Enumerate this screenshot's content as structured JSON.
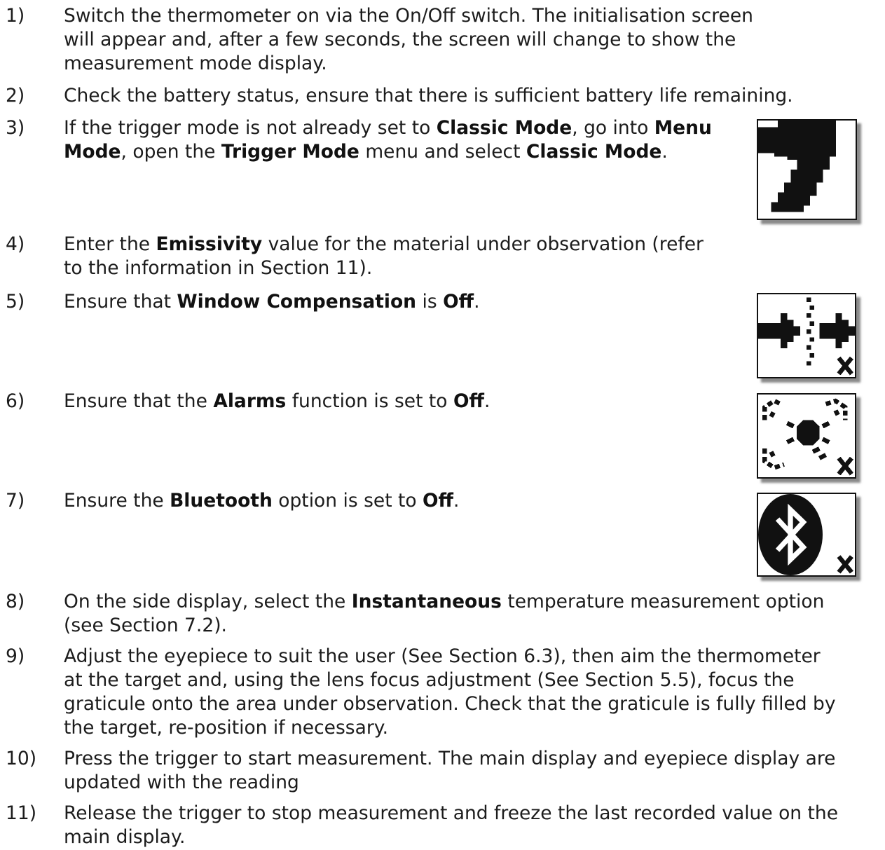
{
  "steps": [
    {
      "num": "1)",
      "parts": [
        {
          "t": "Switch the thermometer on via the On/Off switch. The initialisation screen will appear and, after a few seconds, the screen will change to show the measurement mode display."
        }
      ]
    },
    {
      "num": "2)",
      "parts": [
        {
          "t": "Check the battery status, ensure that there is sufficient battery life remaining."
        }
      ]
    },
    {
      "num": "3)",
      "parts": [
        {
          "t": "If the trigger mode is not already set to "
        },
        {
          "t": "Classic Mode",
          "b": true
        },
        {
          "t": ", go into "
        },
        {
          "t": "Menu Mode",
          "b": true
        },
        {
          "t": ", open the "
        },
        {
          "t": "Trigger Mode",
          "b": true
        },
        {
          "t": " menu and select "
        },
        {
          "t": "Classic Mode",
          "b": true
        },
        {
          "t": "."
        }
      ]
    },
    {
      "num": "4)",
      "parts": [
        {
          "t": "Enter the "
        },
        {
          "t": "Emissivity",
          "b": true
        },
        {
          "t": " value for the material under observation (refer to the information in Section 11)."
        }
      ]
    },
    {
      "num": "5)",
      "parts": [
        {
          "t": "Ensure that "
        },
        {
          "t": "Window Compensation",
          "b": true
        },
        {
          "t": " is "
        },
        {
          "t": "Off",
          "b": true
        },
        {
          "t": "."
        }
      ]
    },
    {
      "num": "6)",
      "parts": [
        {
          "t": "Ensure that the "
        },
        {
          "t": "Alarms",
          "b": true
        },
        {
          "t": " function is set to "
        },
        {
          "t": "Off",
          "b": true
        },
        {
          "t": "."
        }
      ]
    },
    {
      "num": "7)",
      "parts": [
        {
          "t": "Ensure the "
        },
        {
          "t": "Bluetooth",
          "b": true
        },
        {
          "t": " option is set to "
        },
        {
          "t": "Off",
          "b": true
        },
        {
          "t": "."
        }
      ]
    },
    {
      "num": "8)",
      "parts": [
        {
          "t": "On the side display, select the "
        },
        {
          "t": "Instantaneous",
          "b": true
        },
        {
          "t": " temperature measurement option (see Section 7.2)."
        }
      ]
    },
    {
      "num": "9)",
      "parts": [
        {
          "t": "Adjust the eyepiece to suit the user (See Section 6.3), then aim the thermometer at the target and, using the lens focus adjustment (See Section 5.5), focus the graticule onto the area under observation. Check that the graticule is fully filled by the target, re-position if necessary."
        }
      ]
    },
    {
      "num": "10)",
      "parts": [
        {
          "t": "Press the trigger to start measurement. The main display and eyepiece display are updated with the reading"
        }
      ]
    },
    {
      "num": "11)",
      "parts": [
        {
          "t": "Release the trigger to stop measurement and freeze the last recorded value on the main display."
        }
      ]
    }
  ],
  "icons": [
    {
      "name": "trigger-mode-icon"
    },
    {
      "name": "window-compensation-off-icon"
    },
    {
      "name": "alarms-off-icon"
    },
    {
      "name": "bluetooth-off-icon"
    }
  ]
}
